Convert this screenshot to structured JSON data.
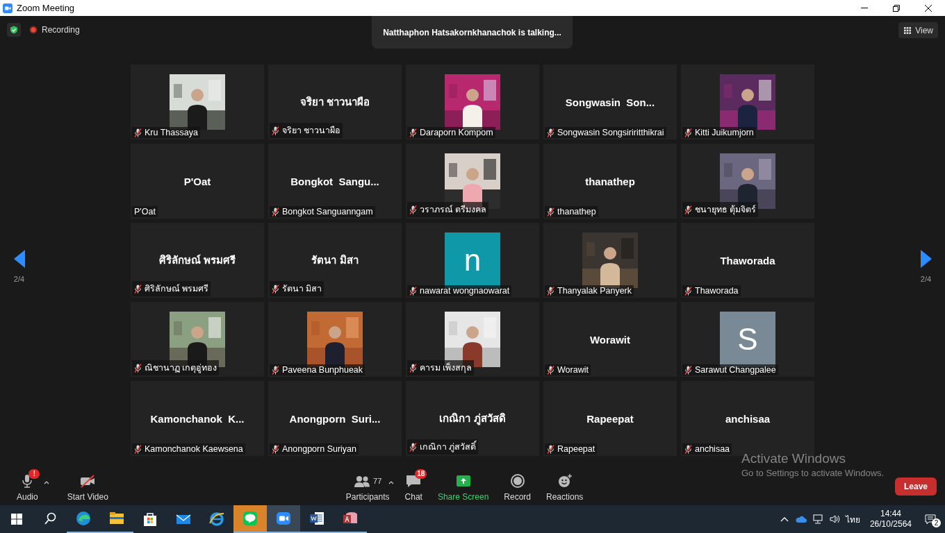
{
  "window": {
    "title": "Zoom Meeting"
  },
  "top_bar": {
    "recording": "Recording",
    "talking": "Natthaphon Hatsakornkhanachok is talking...",
    "view": "View"
  },
  "pager": {
    "left": "2/4",
    "right": "2/4"
  },
  "tiles": [
    {
      "label": "Kru Thassaya",
      "muted": true
    },
    {
      "kind": "name",
      "display": "จริยา ชาวนาผือ",
      "label": "จริยา ชาวนาผือ",
      "muted": true
    },
    {
      "label": "Daraporn Kompom",
      "muted": true
    },
    {
      "kind": "name",
      "display": "Songwasin  Son...",
      "label": "Songwasin Songsiriritthikrai",
      "muted": true
    },
    {
      "label": "Kitti Juikumjorn",
      "muted": true
    },
    {
      "kind": "name",
      "display": "P'Oat",
      "label": "P'Oat",
      "muted": false
    },
    {
      "kind": "name",
      "display": "Bongkot  Sangu...",
      "label": "Bongkot Sanguanngam",
      "muted": true
    },
    {
      "label": "วราภรณ์ ตรีมงคล",
      "muted": true
    },
    {
      "kind": "name",
      "display": "thanathep",
      "label": "thanathep",
      "muted": true
    },
    {
      "label": "ชนายุทธ ตุ้มจิตร์",
      "muted": true
    },
    {
      "kind": "name",
      "display": "ศิริลักษณ์ พรมศรี",
      "label": "ศิริลักษณ์ พรมศรี",
      "muted": true
    },
    {
      "kind": "name",
      "display": "รัตนา มิสา",
      "label": "รัตนา มิสา",
      "muted": true
    },
    {
      "kind": "avatar",
      "letter": "n",
      "color": "#0e98a8",
      "label": "nawarat wongnaowarat",
      "muted": true
    },
    {
      "label": "Thanyalak Panyerk",
      "muted": true
    },
    {
      "kind": "name",
      "display": "Thaworada",
      "label": "Thaworada",
      "muted": true
    },
    {
      "label": "ณิชานาฏ เกตุอู่ทอง",
      "muted": true
    },
    {
      "label": "Paveena Bunphueak",
      "muted": true
    },
    {
      "label": "คารม เพ็งสกุล",
      "muted": true
    },
    {
      "kind": "name",
      "display": "Worawit",
      "label": "Worawit",
      "muted": true
    },
    {
      "kind": "avatar",
      "letter": "S",
      "color": "#798a96",
      "label": "Sarawut Changpalee",
      "muted": true
    },
    {
      "kind": "name",
      "display": "Kamonchanok  K...",
      "label": "Kamonchanok Kaewsena",
      "muted": true
    },
    {
      "kind": "name",
      "display": "Anongporn  Suri...",
      "label": "Anongporn Suriyan",
      "muted": true
    },
    {
      "kind": "name",
      "display": "เกณิกา ภู่สวัสดิ",
      "label": "เกณิกา ภู่สวัสดิ์",
      "muted": true
    },
    {
      "kind": "name",
      "display": "Rapeepat",
      "label": "Rapeepat",
      "muted": true
    },
    {
      "kind": "name",
      "display": "anchisaa",
      "label": "anchisaa",
      "muted": true
    }
  ],
  "toolbar": {
    "left": [
      {
        "kind": "audio",
        "label": "Audio",
        "badge": "!"
      },
      {
        "kind": "video",
        "label": "Start Video"
      }
    ],
    "center": [
      {
        "kind": "participants",
        "label": "Participants",
        "count": "77"
      },
      {
        "kind": "chat",
        "label": "Chat",
        "badge": "18"
      },
      {
        "kind": "share",
        "label": "Share Screen"
      },
      {
        "kind": "record",
        "label": "Record"
      },
      {
        "kind": "reactions",
        "label": "Reactions"
      }
    ],
    "leave": "Leave"
  },
  "activation": {
    "title": "Activate Windows",
    "subtitle": "Go to Settings to activate Windows."
  },
  "taskbar": {
    "apps": [
      {
        "kind": "start",
        "running": false,
        "active": false,
        "attention": false
      },
      {
        "kind": "search",
        "running": false,
        "active": false,
        "attention": false
      },
      {
        "kind": "edge",
        "running": true,
        "active": false,
        "attention": false
      },
      {
        "kind": "explorer",
        "running": true,
        "active": false,
        "attention": false
      },
      {
        "kind": "store",
        "running": false,
        "active": false,
        "attention": false
      },
      {
        "kind": "mail",
        "running": false,
        "active": false,
        "attention": false
      },
      {
        "kind": "ie",
        "running": false,
        "active": false,
        "attention": false
      },
      {
        "kind": "line",
        "running": true,
        "active": false,
        "attention": true
      },
      {
        "kind": "zoom",
        "running": true,
        "active": true,
        "attention": false
      },
      {
        "kind": "word",
        "running": true,
        "active": false,
        "attention": false
      },
      {
        "kind": "access",
        "running": true,
        "active": false,
        "attention": false
      }
    ],
    "language": "ไทย",
    "time": "14:44",
    "date": "26/10/2564",
    "notifications": "2"
  }
}
